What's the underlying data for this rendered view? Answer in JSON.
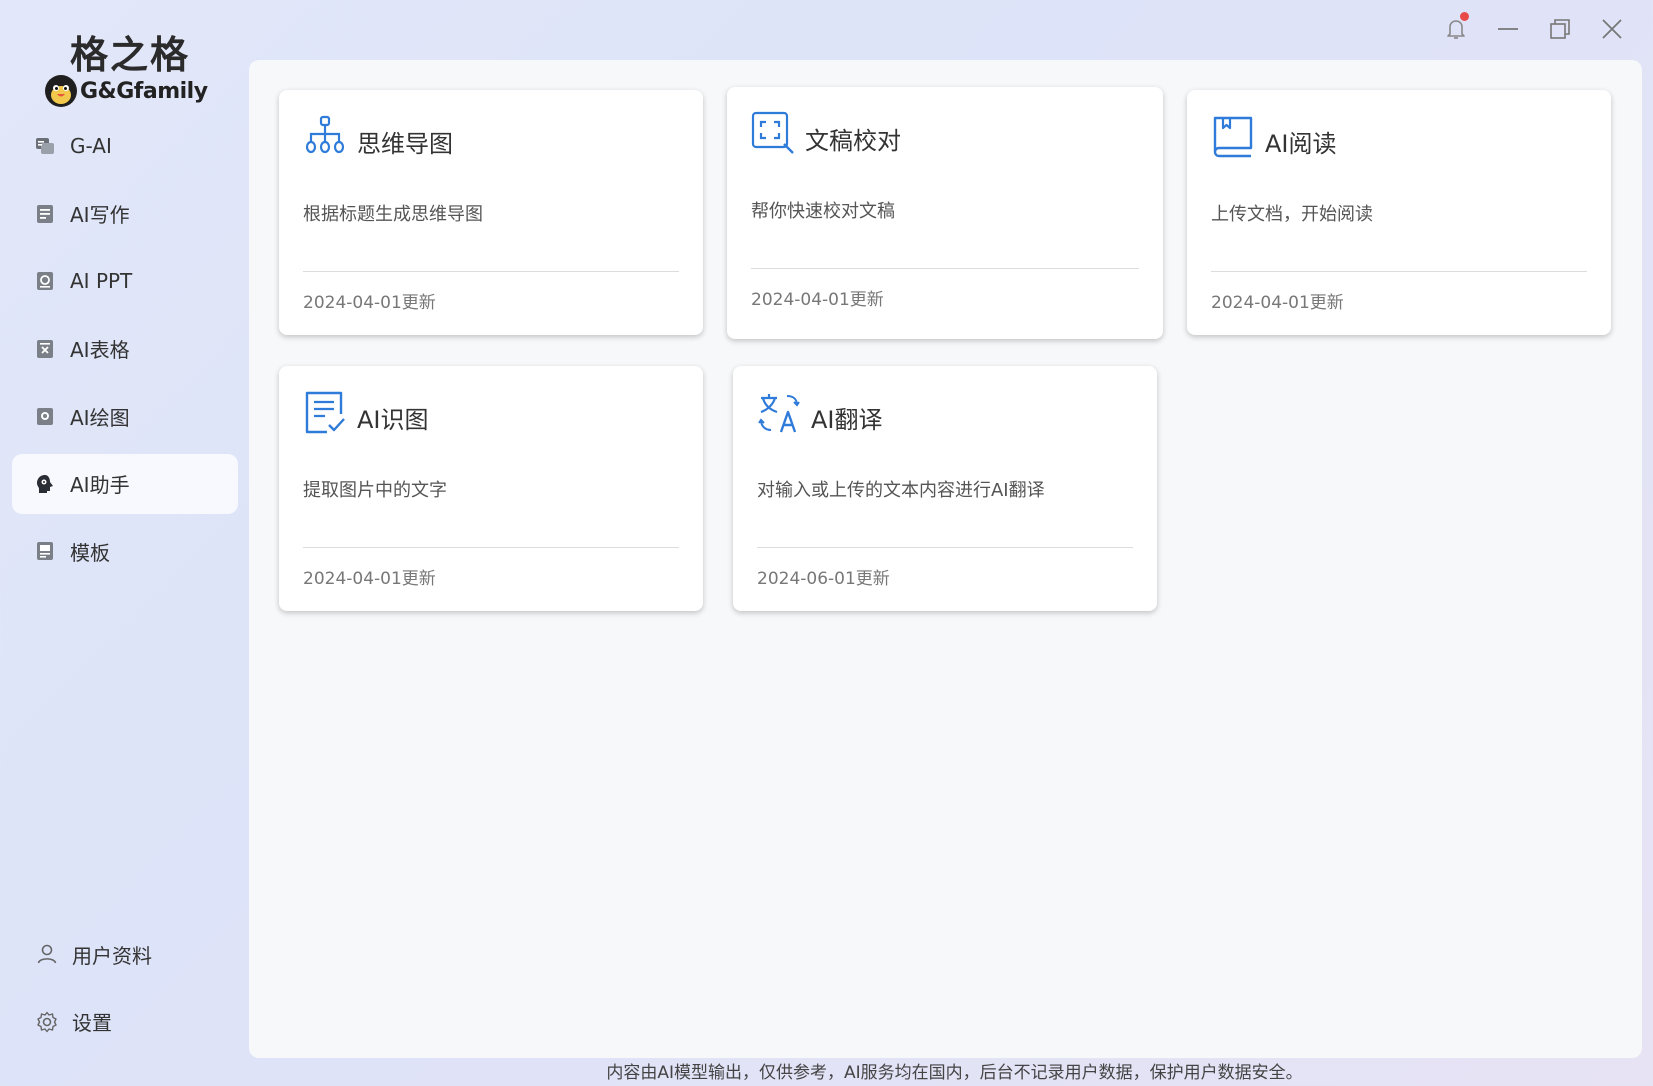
{
  "app": {
    "logo_cn": "格之格",
    "logo_en": "G&Gfamily"
  },
  "sidebar": {
    "items": [
      {
        "label": "G-AI",
        "icon": "chat-icon"
      },
      {
        "label": "AI写作",
        "icon": "writing-icon"
      },
      {
        "label": "AI PPT",
        "icon": "ppt-icon"
      },
      {
        "label": "AI表格",
        "icon": "table-icon"
      },
      {
        "label": "AI绘图",
        "icon": "painting-icon"
      },
      {
        "label": "AI助手",
        "icon": "assistant-icon",
        "active": true
      },
      {
        "label": "模板",
        "icon": "template-icon"
      }
    ],
    "bottom": [
      {
        "label": "用户资料",
        "icon": "user-icon"
      },
      {
        "label": "设置",
        "icon": "gear-icon"
      }
    ]
  },
  "cards": [
    {
      "title": "思维导图",
      "desc": "根据标题生成思维导图",
      "date": "2024-04-01更新",
      "icon": "mindmap-icon"
    },
    {
      "title": "文稿校对",
      "desc": "帮你快速校对文稿",
      "date": "2024-04-01更新",
      "icon": "proofread-icon"
    },
    {
      "title": "AI阅读",
      "desc": "上传文档，开始阅读",
      "date": "2024-04-01更新",
      "icon": "book-icon"
    },
    {
      "title": "AI识图",
      "desc": "提取图片中的文字",
      "date": "2024-04-01更新",
      "icon": "image-text-icon"
    },
    {
      "title": "AI翻译",
      "desc": "对输入或上传的文本内容进行AI翻译",
      "date": "2024-06-01更新",
      "icon": "translate-icon"
    }
  ],
  "footer": {
    "notice": "内容由AI模型输出，仅供参考，AI服务均在国内，后台不记录用户数据，保护用户数据安全。"
  },
  "colors": {
    "accent": "#2f7bd9",
    "notification_dot": "#e84a4a"
  }
}
